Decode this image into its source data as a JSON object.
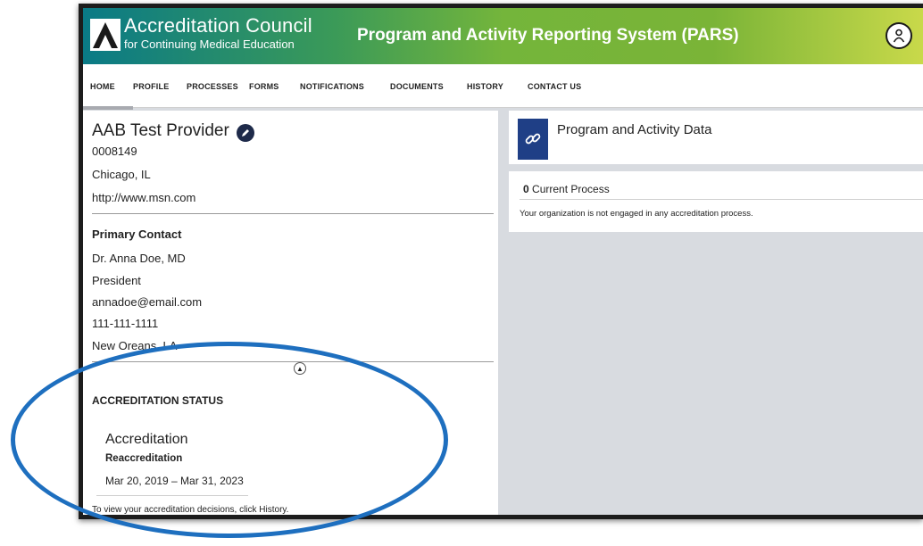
{
  "header": {
    "org_name": "Accreditation Council",
    "org_sub": "for Continuing Medical Education",
    "app_title": "Program and Activity Reporting System (PARS)"
  },
  "nav": [
    "HOME",
    "PROFILE",
    "PROCESSES",
    "FORMS",
    "NOTIFICATIONS",
    "DOCUMENTS",
    "HISTORY",
    "CONTACT US"
  ],
  "provider": {
    "name": "AAB Test Provider",
    "id": "0008149",
    "location": "Chicago, IL",
    "website": "http://www.msn.com"
  },
  "contact": {
    "heading": "Primary Contact",
    "name": "Dr. Anna Doe, MD",
    "title": "President",
    "email": "annadoe@email.com",
    "phone": "111-111-1111",
    "city": "New Oreans, LA"
  },
  "status": {
    "heading": "ACCREDITATION STATUS",
    "type": "Accreditation",
    "subtype": "Reaccreditation",
    "dates": "Mar 20, 2019 – Mar 31, 2023",
    "note": "To view your accreditation decisions, click History."
  },
  "right": {
    "title": "Program and Activity Data",
    "process_count": "0",
    "process_label": "Current Process",
    "process_msg": "Your organization is not engaged in any accreditation process."
  },
  "colors": {
    "highlight": "#1e6fbf",
    "link_icon_bg": "#1f3f86"
  }
}
